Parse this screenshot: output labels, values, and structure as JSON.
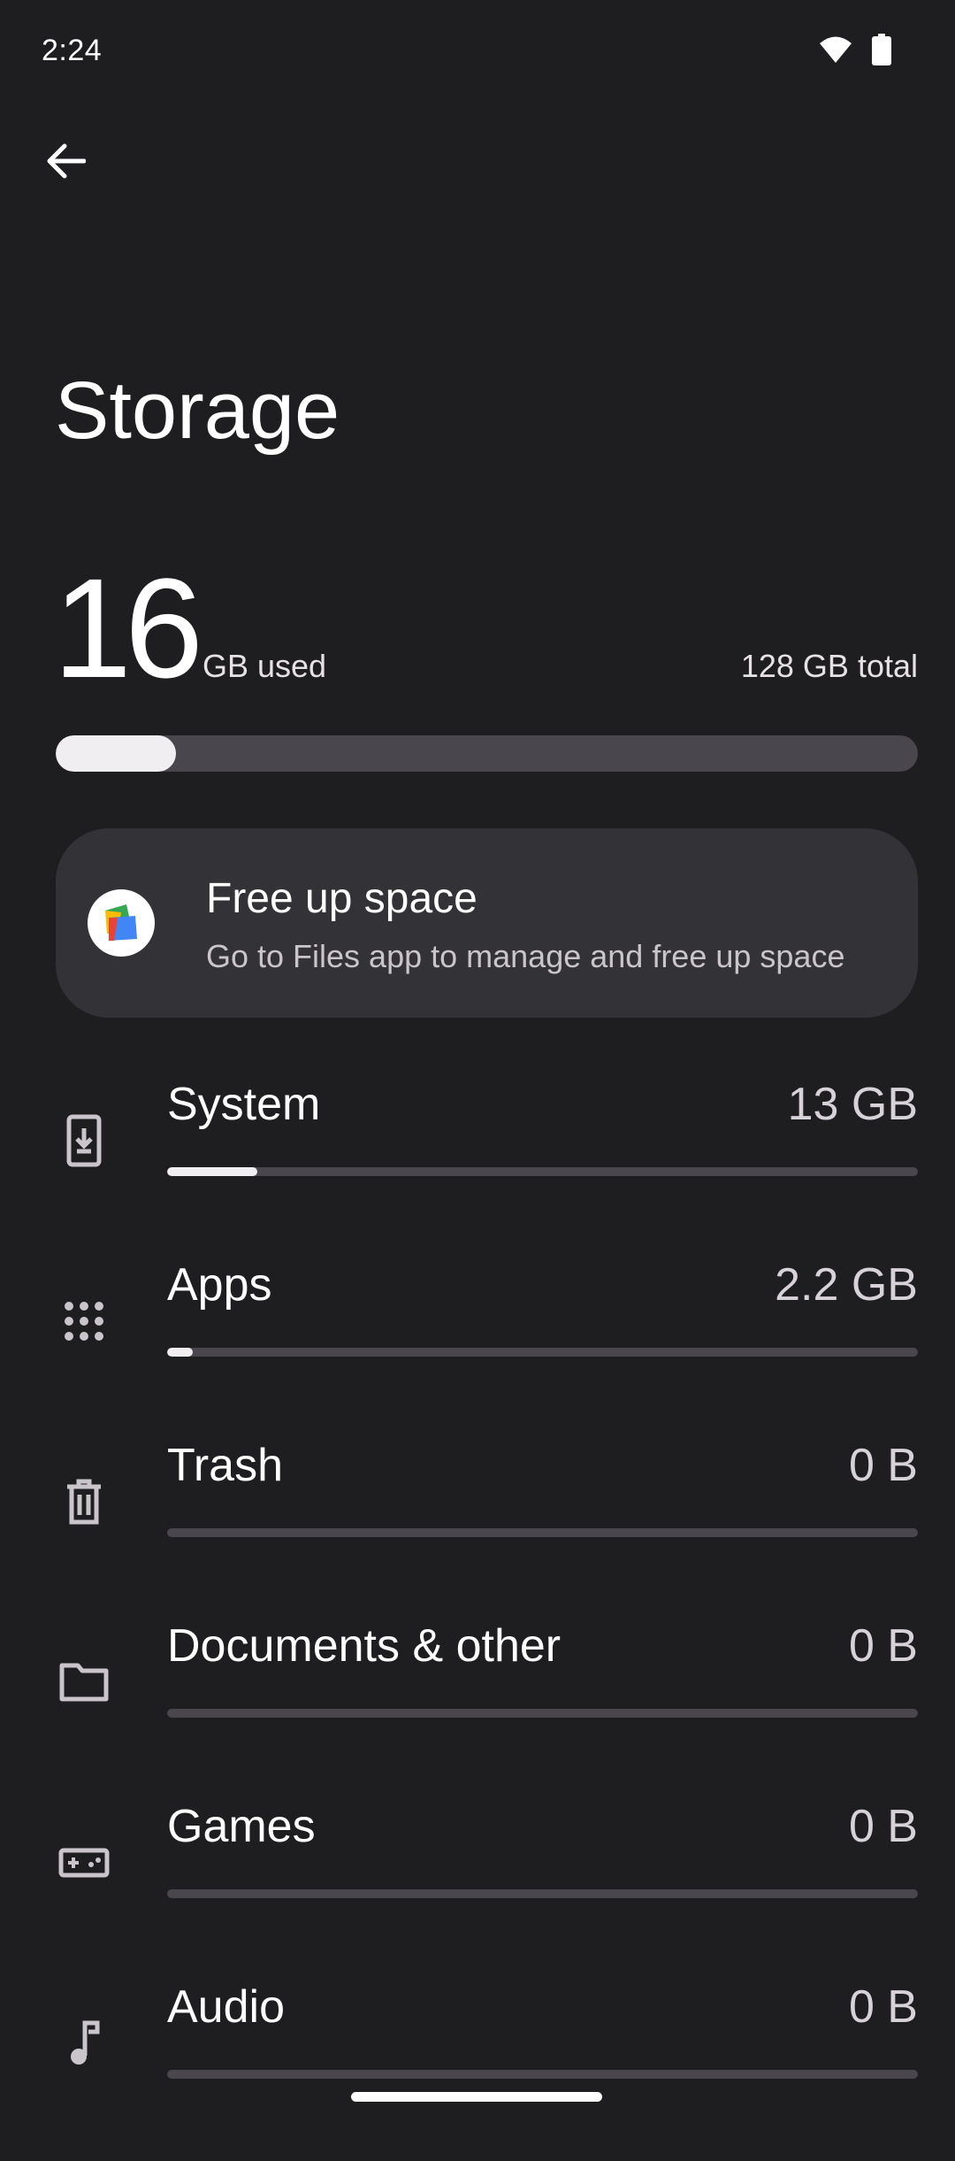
{
  "status_bar": {
    "time": "2:24",
    "icons": [
      "wifi-icon",
      "battery-icon"
    ]
  },
  "header": {
    "back_icon": "arrow-back-icon",
    "title": "Storage"
  },
  "summary": {
    "used_value": "16",
    "used_unit": "GB used",
    "total": "128 GB total",
    "used_fraction": 0.139
  },
  "free_up": {
    "icon": "files-app-icon",
    "title": "Free up space",
    "subtitle": "Go to Files app to manage and free up space"
  },
  "categories": [
    {
      "icon": "system-update-icon",
      "label": "System",
      "size": "13 GB",
      "fraction": 0.12
    },
    {
      "icon": "apps-grid-icon",
      "label": "Apps",
      "size": "2.2 GB",
      "fraction": 0.034
    },
    {
      "icon": "trash-icon",
      "label": "Trash",
      "size": "0 B",
      "fraction": 0
    },
    {
      "icon": "folder-icon",
      "label": "Documents & other",
      "size": "0 B",
      "fraction": 0
    },
    {
      "icon": "gamepad-icon",
      "label": "Games",
      "size": "0 B",
      "fraction": 0
    },
    {
      "icon": "music-note-icon",
      "label": "Audio",
      "size": "0 B",
      "fraction": 0
    }
  ],
  "colors": {
    "background": "#1e1d20",
    "card": "#333236",
    "track": "#49474d",
    "fill": "#f0eef0"
  }
}
